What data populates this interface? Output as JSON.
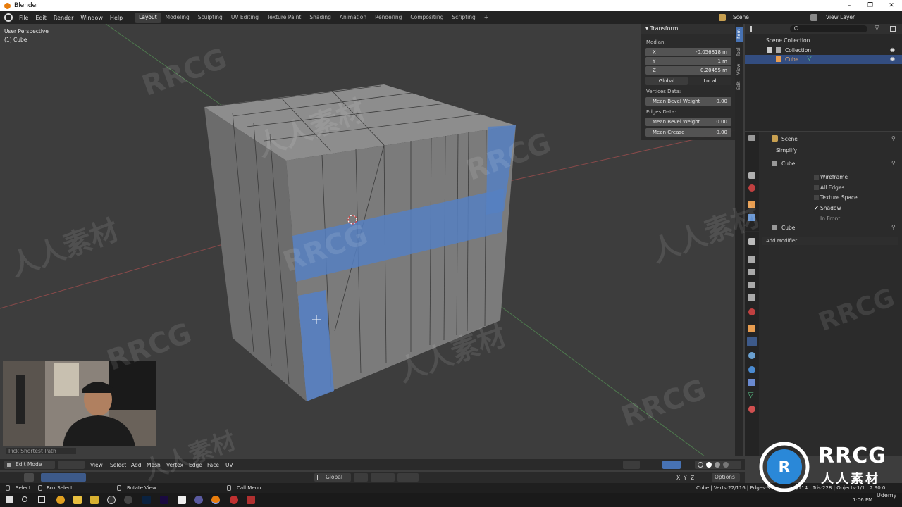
{
  "titlebar": {
    "title": "Blender"
  },
  "menu": {
    "file": "File",
    "edit": "Edit",
    "render": "Render",
    "window": "Window",
    "help": "Help"
  },
  "workspaces": [
    "Layout",
    "Modeling",
    "Sculpting",
    "UV Editing",
    "Texture Paint",
    "Shading",
    "Animation",
    "Rendering",
    "Compositing",
    "Scripting",
    "+"
  ],
  "scene_selector": {
    "scene": "Scene",
    "view_layer": "View Layer"
  },
  "viewport": {
    "perspective": "User Perspective",
    "object": "(1) Cube",
    "last_op": "Pick Shortest Path"
  },
  "transform_panel": {
    "title": "Transform",
    "median_label": "Median:",
    "x_label": "X",
    "x_value": "-0.056818 m",
    "y_label": "Y",
    "y_value": "1 m",
    "z_label": "Z",
    "z_value": "0.20455 m",
    "global": "Global",
    "local": "Local",
    "vertices_data": "Vertices Data:",
    "mean_bevel_weight_v": "Mean Bevel Weight",
    "mean_bevel_weight_v_value": "0.00",
    "edges_data": "Edges Data:",
    "mean_bevel_weight_e": "Mean Bevel Weight",
    "mean_bevel_weight_e_value": "0.00",
    "mean_crease": "Mean Crease",
    "mean_crease_value": "0.00"
  },
  "sidebar_tabs": [
    "Item",
    "Tool",
    "View",
    "Edit"
  ],
  "outliner": {
    "scene_collection": "Scene Collection",
    "collection": "Collection",
    "cube": "Cube"
  },
  "properties_top": {
    "scene": "Scene",
    "simplify": "Simplify",
    "object": "Cube",
    "wireframe": "Wireframe",
    "all_edges": "All Edges",
    "texture_space": "Texture Space",
    "shadow": "Shadow",
    "in_front": "In Front"
  },
  "modifiers": {
    "object": "Cube",
    "add_modifier": "Add Modifier"
  },
  "view3d_header": {
    "mode": "Edit Mode",
    "view": "View",
    "select": "Select",
    "add": "Add",
    "mesh": "Mesh",
    "vertex": "Vertex",
    "edge": "Edge",
    "face": "Face",
    "uv": "UV",
    "orientation": "Global",
    "options": "Options",
    "x": "X",
    "y": "Y",
    "z": "Z"
  },
  "statusbar": {
    "select": "Select",
    "box_select": "Box Select",
    "rotate_view": "Rotate View",
    "call_menu": "Call Menu",
    "stats": "Cube | Verts:22/116 | Edges:3",
    "stats2": "0/114 | Tris:228 | Objects:1/1 | 2.90.0"
  },
  "taskbar": {
    "time": "1:06 PM"
  },
  "watermarks": [
    "RRCG",
    "人人素材"
  ],
  "brand": {
    "logo_text": "RRCG",
    "logo_sub": "人人素材",
    "udemy": "Udemy"
  },
  "colors": {
    "selection": "#5680c2",
    "header": "#232323",
    "viewport_bg": "#3d3d3d",
    "active_tab": "#4772b3"
  }
}
